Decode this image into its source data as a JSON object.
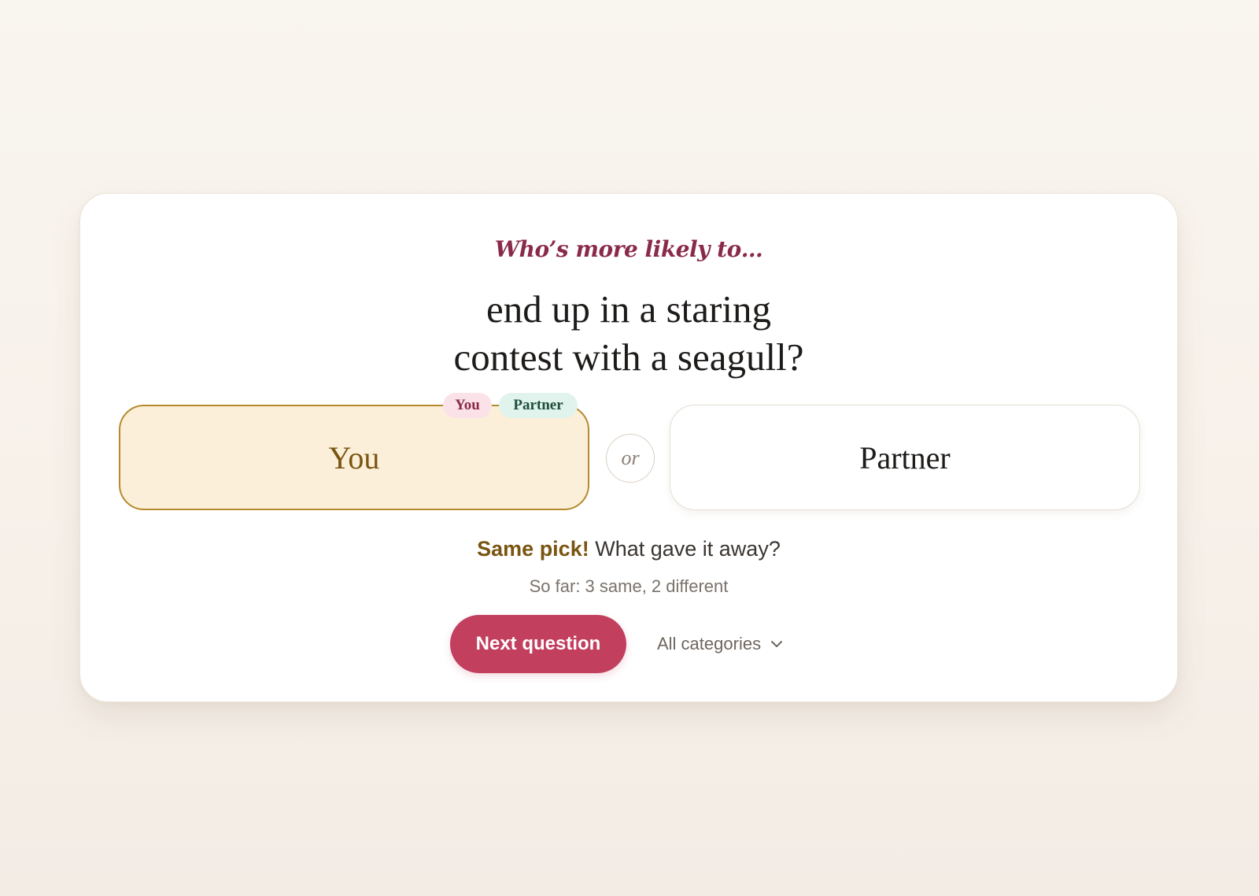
{
  "prompt": {
    "eyebrow": "Who’s more likely to…",
    "question_line1": "end up in a staring",
    "question_line2": "contest with a seagull?"
  },
  "choices": {
    "you_label": "You",
    "partner_label": "Partner",
    "separator": "or",
    "selected": "You"
  },
  "picks": {
    "you_badge": "You",
    "partner_badge": "Partner"
  },
  "result": {
    "highlight": "Same pick!",
    "message": " What gave it away?",
    "tally": "So far: 3 same, 2 different"
  },
  "actions": {
    "next_label": "Next question",
    "category_label": "All categories",
    "category_icon": "chevron-down-icon"
  },
  "colors": {
    "accent": "#c23f5e",
    "eyebrow": "#8a2a4a",
    "selected_fill": "#fbefd9",
    "selected_border": "#b58a2e",
    "you_badge_bg": "#fbe2e8",
    "partner_badge_bg": "#e0f3ec"
  }
}
